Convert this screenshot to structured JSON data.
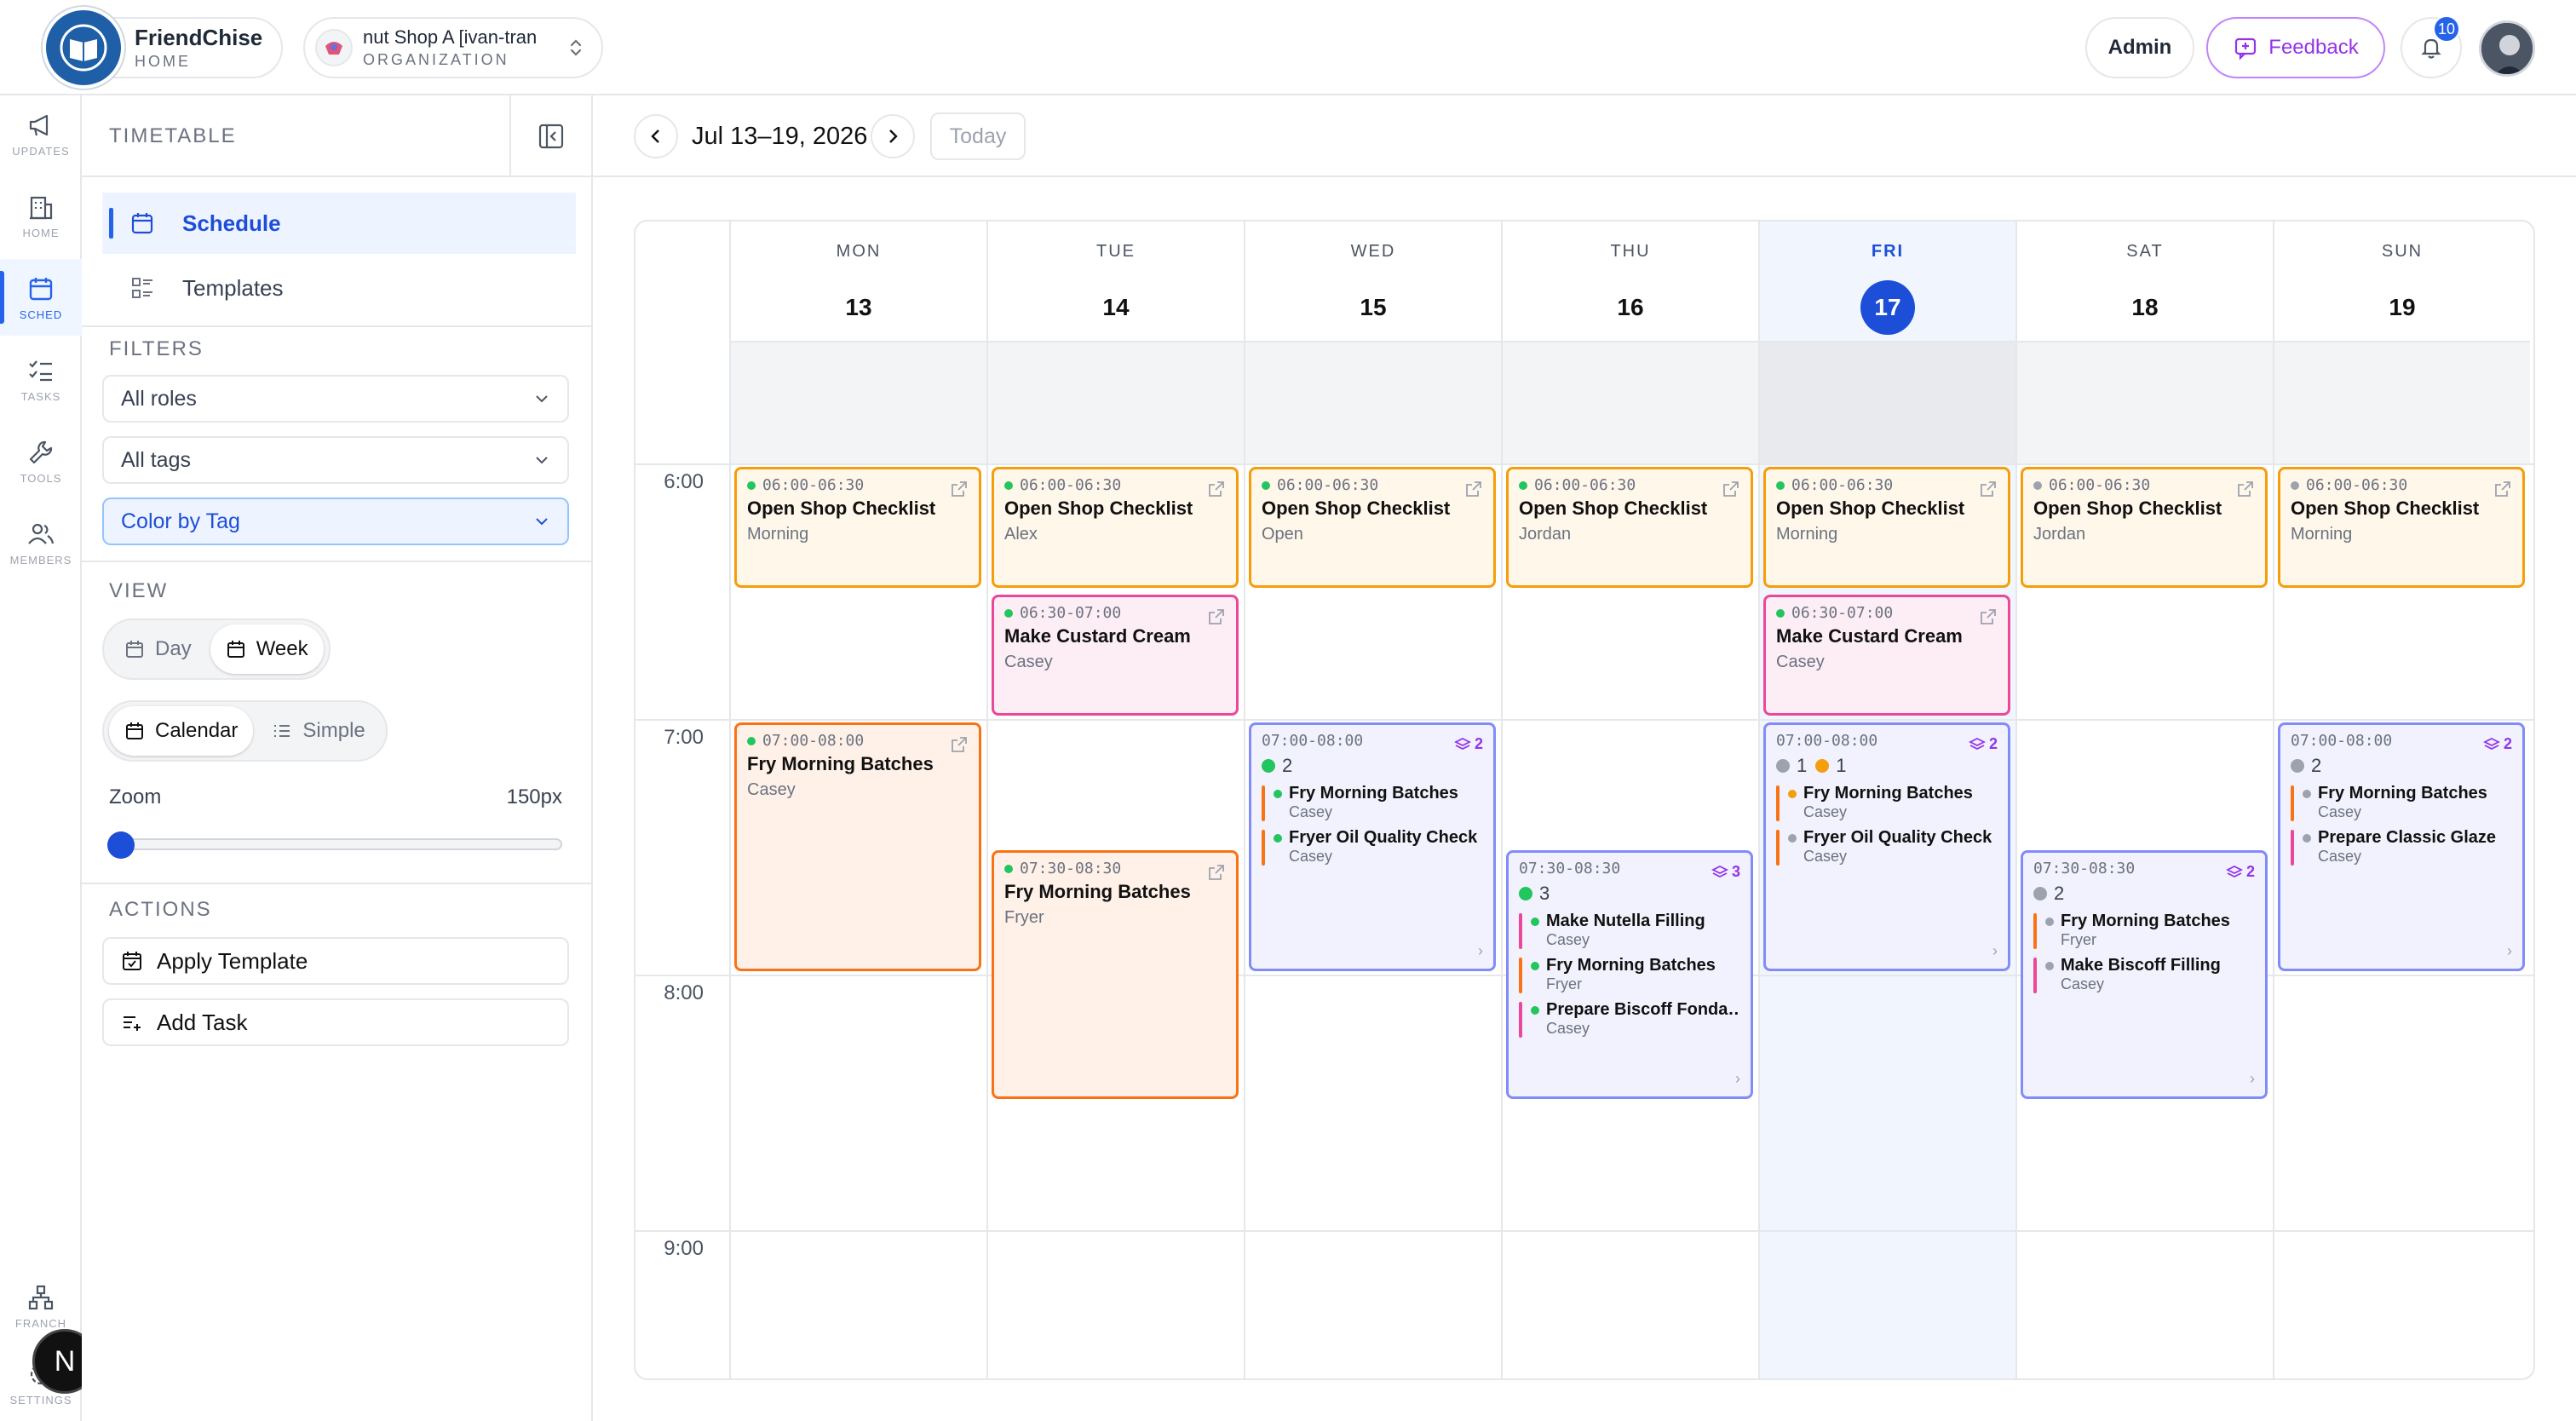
{
  "brand": {
    "name": "FriendChise",
    "sub": "HOME"
  },
  "org": {
    "name": "nut Shop A [ivan-tran",
    "sub": "ORGANIZATION"
  },
  "topbar": {
    "admin": "Admin",
    "feedback": "Feedback",
    "notifications": "10"
  },
  "rail": [
    {
      "label": "UPDATES",
      "icon": "megaphone-icon"
    },
    {
      "label": "HOME",
      "icon": "building-icon"
    },
    {
      "label": "SCHED",
      "icon": "calendar-icon",
      "active": true
    },
    {
      "label": "TASKS",
      "icon": "task-list-icon"
    },
    {
      "label": "TOOLS",
      "icon": "wrench-icon"
    },
    {
      "label": "MEMBERS",
      "icon": "users-icon"
    },
    {
      "label": "FRANCH",
      "icon": "hierarchy-icon"
    },
    {
      "label": "SETTINGS",
      "icon": "gear-icon"
    }
  ],
  "n_badge": "N",
  "panel": {
    "title": "TIMETABLE",
    "nav": {
      "schedule": "Schedule",
      "templates": "Templates"
    },
    "filters_title": "FILTERS",
    "roles": "All roles",
    "tags": "All tags",
    "color_by": "Color by Tag",
    "view_title": "VIEW",
    "view_day": "Day",
    "view_week": "Week",
    "mode_calendar": "Calendar",
    "mode_simple": "Simple",
    "zoom_label": "Zoom",
    "zoom_value": "150px",
    "zoom_level": 0,
    "actions_title": "ACTIONS",
    "apply_template": "Apply Template",
    "add_task": "Add Task"
  },
  "toolbar": {
    "range": "Jul 13–19, 2026",
    "today": "Today"
  },
  "calendar": {
    "days": [
      {
        "dow": "MON",
        "num": "13"
      },
      {
        "dow": "TUE",
        "num": "14"
      },
      {
        "dow": "WED",
        "num": "15"
      },
      {
        "dow": "THU",
        "num": "16"
      },
      {
        "dow": "FRI",
        "num": "17",
        "today": true
      },
      {
        "dow": "SAT",
        "num": "18"
      },
      {
        "dow": "SUN",
        "num": "19"
      }
    ],
    "hours": [
      "6:00",
      "7:00",
      "8:00",
      "9:00"
    ],
    "events": [
      {
        "day": 0,
        "start": 6.0,
        "end": 6.5,
        "kind": "orange",
        "time": "06:00-06:30",
        "title": "Open Shop Checklist",
        "sub": "Morning",
        "dot": "#22c55e"
      },
      {
        "day": 1,
        "start": 6.0,
        "end": 6.5,
        "kind": "orange",
        "time": "06:00-06:30",
        "title": "Open Shop Checklist",
        "sub": "Alex",
        "dot": "#22c55e"
      },
      {
        "day": 2,
        "start": 6.0,
        "end": 6.5,
        "kind": "orange",
        "time": "06:00-06:30",
        "title": "Open Shop Checklist",
        "sub": "Open",
        "dot": "#22c55e"
      },
      {
        "day": 3,
        "start": 6.0,
        "end": 6.5,
        "kind": "orange",
        "time": "06:00-06:30",
        "title": "Open Shop Checklist",
        "sub": "Jordan",
        "dot": "#22c55e"
      },
      {
        "day": 4,
        "start": 6.0,
        "end": 6.5,
        "kind": "orange",
        "time": "06:00-06:30",
        "title": "Open Shop Checklist",
        "sub": "Morning",
        "dot": "#22c55e"
      },
      {
        "day": 5,
        "start": 6.0,
        "end": 6.5,
        "kind": "orange",
        "time": "06:00-06:30",
        "title": "Open Shop Checklist",
        "sub": "Jordan",
        "dot": "#9ca3af"
      },
      {
        "day": 6,
        "start": 6.0,
        "end": 6.5,
        "kind": "orange",
        "time": "06:00-06:30",
        "title": "Open Shop Checklist",
        "sub": "Morning",
        "dot": "#9ca3af"
      },
      {
        "day": 1,
        "start": 6.5,
        "end": 7.0,
        "kind": "pink",
        "time": "06:30-07:00",
        "title": "Make Custard Cream",
        "sub": "Casey",
        "dot": "#22c55e"
      },
      {
        "day": 4,
        "start": 6.5,
        "end": 7.0,
        "kind": "pink",
        "time": "06:30-07:00",
        "title": "Make Custard Cream",
        "sub": "Casey",
        "dot": "#22c55e"
      },
      {
        "day": 0,
        "start": 7.0,
        "end": 8.0,
        "kind": "orange2",
        "time": "07:00-08:00",
        "title": "Fry Morning Batches",
        "sub": "Casey",
        "dot": "#22c55e"
      },
      {
        "day": 1,
        "start": 7.5,
        "end": 8.5,
        "kind": "orange2",
        "time": "07:30-08:30",
        "title": "Fry Morning Batches",
        "sub": "Fryer",
        "dot": "#22c55e"
      },
      {
        "day": 2,
        "start": 7.0,
        "end": 8.0,
        "kind": "group",
        "time": "07:00-08:00",
        "count": "2",
        "status": [
          {
            "color": "#22c55e",
            "n": "2"
          }
        ],
        "items": [
          {
            "title": "Fry Morning Batches",
            "sub": "Casey",
            "bar": "#f97316",
            "dot": "#22c55e"
          },
          {
            "title": "Fryer Oil Quality Check",
            "sub": "Casey",
            "bar": "#f97316",
            "dot": "#22c55e"
          }
        ]
      },
      {
        "day": 3,
        "start": 7.5,
        "end": 8.5,
        "kind": "group",
        "time": "07:30-08:30",
        "count": "3",
        "status": [
          {
            "color": "#22c55e",
            "n": "3"
          }
        ],
        "items": [
          {
            "title": "Make Nutella Filling",
            "sub": "Casey",
            "bar": "#ec4899",
            "dot": "#22c55e"
          },
          {
            "title": "Fry Morning Batches",
            "sub": "Fryer",
            "bar": "#f97316",
            "dot": "#22c55e"
          },
          {
            "title": "Prepare Biscoff Fonda…",
            "sub": "Casey",
            "bar": "#ec4899",
            "dot": "#22c55e"
          }
        ]
      },
      {
        "day": 4,
        "start": 7.0,
        "end": 8.0,
        "kind": "group",
        "time": "07:00-08:00",
        "count": "2",
        "status": [
          {
            "color": "#9ca3af",
            "n": "1"
          },
          {
            "color": "#f59e0b",
            "n": "1"
          }
        ],
        "items": [
          {
            "title": "Fry Morning Batches",
            "sub": "Casey",
            "bar": "#f97316",
            "dot": "#f59e0b"
          },
          {
            "title": "Fryer Oil Quality Check",
            "sub": "Casey",
            "bar": "#f97316",
            "dot": "#9ca3af"
          }
        ]
      },
      {
        "day": 5,
        "start": 7.5,
        "end": 8.5,
        "kind": "group",
        "time": "07:30-08:30",
        "count": "2",
        "status": [
          {
            "color": "#9ca3af",
            "n": "2"
          }
        ],
        "items": [
          {
            "title": "Fry Morning Batches",
            "sub": "Fryer",
            "bar": "#f97316",
            "dot": "#9ca3af"
          },
          {
            "title": "Make Biscoff Filling",
            "sub": "Casey",
            "bar": "#ec4899",
            "dot": "#9ca3af"
          }
        ]
      },
      {
        "day": 6,
        "start": 7.0,
        "end": 8.0,
        "kind": "group",
        "time": "07:00-08:00",
        "count": "2",
        "status": [
          {
            "color": "#9ca3af",
            "n": "2"
          }
        ],
        "items": [
          {
            "title": "Fry Morning Batches",
            "sub": "Casey",
            "bar": "#f97316",
            "dot": "#9ca3af"
          },
          {
            "title": "Prepare Classic Glaze",
            "sub": "Casey",
            "bar": "#ec4899",
            "dot": "#9ca3af"
          }
        ]
      }
    ]
  }
}
